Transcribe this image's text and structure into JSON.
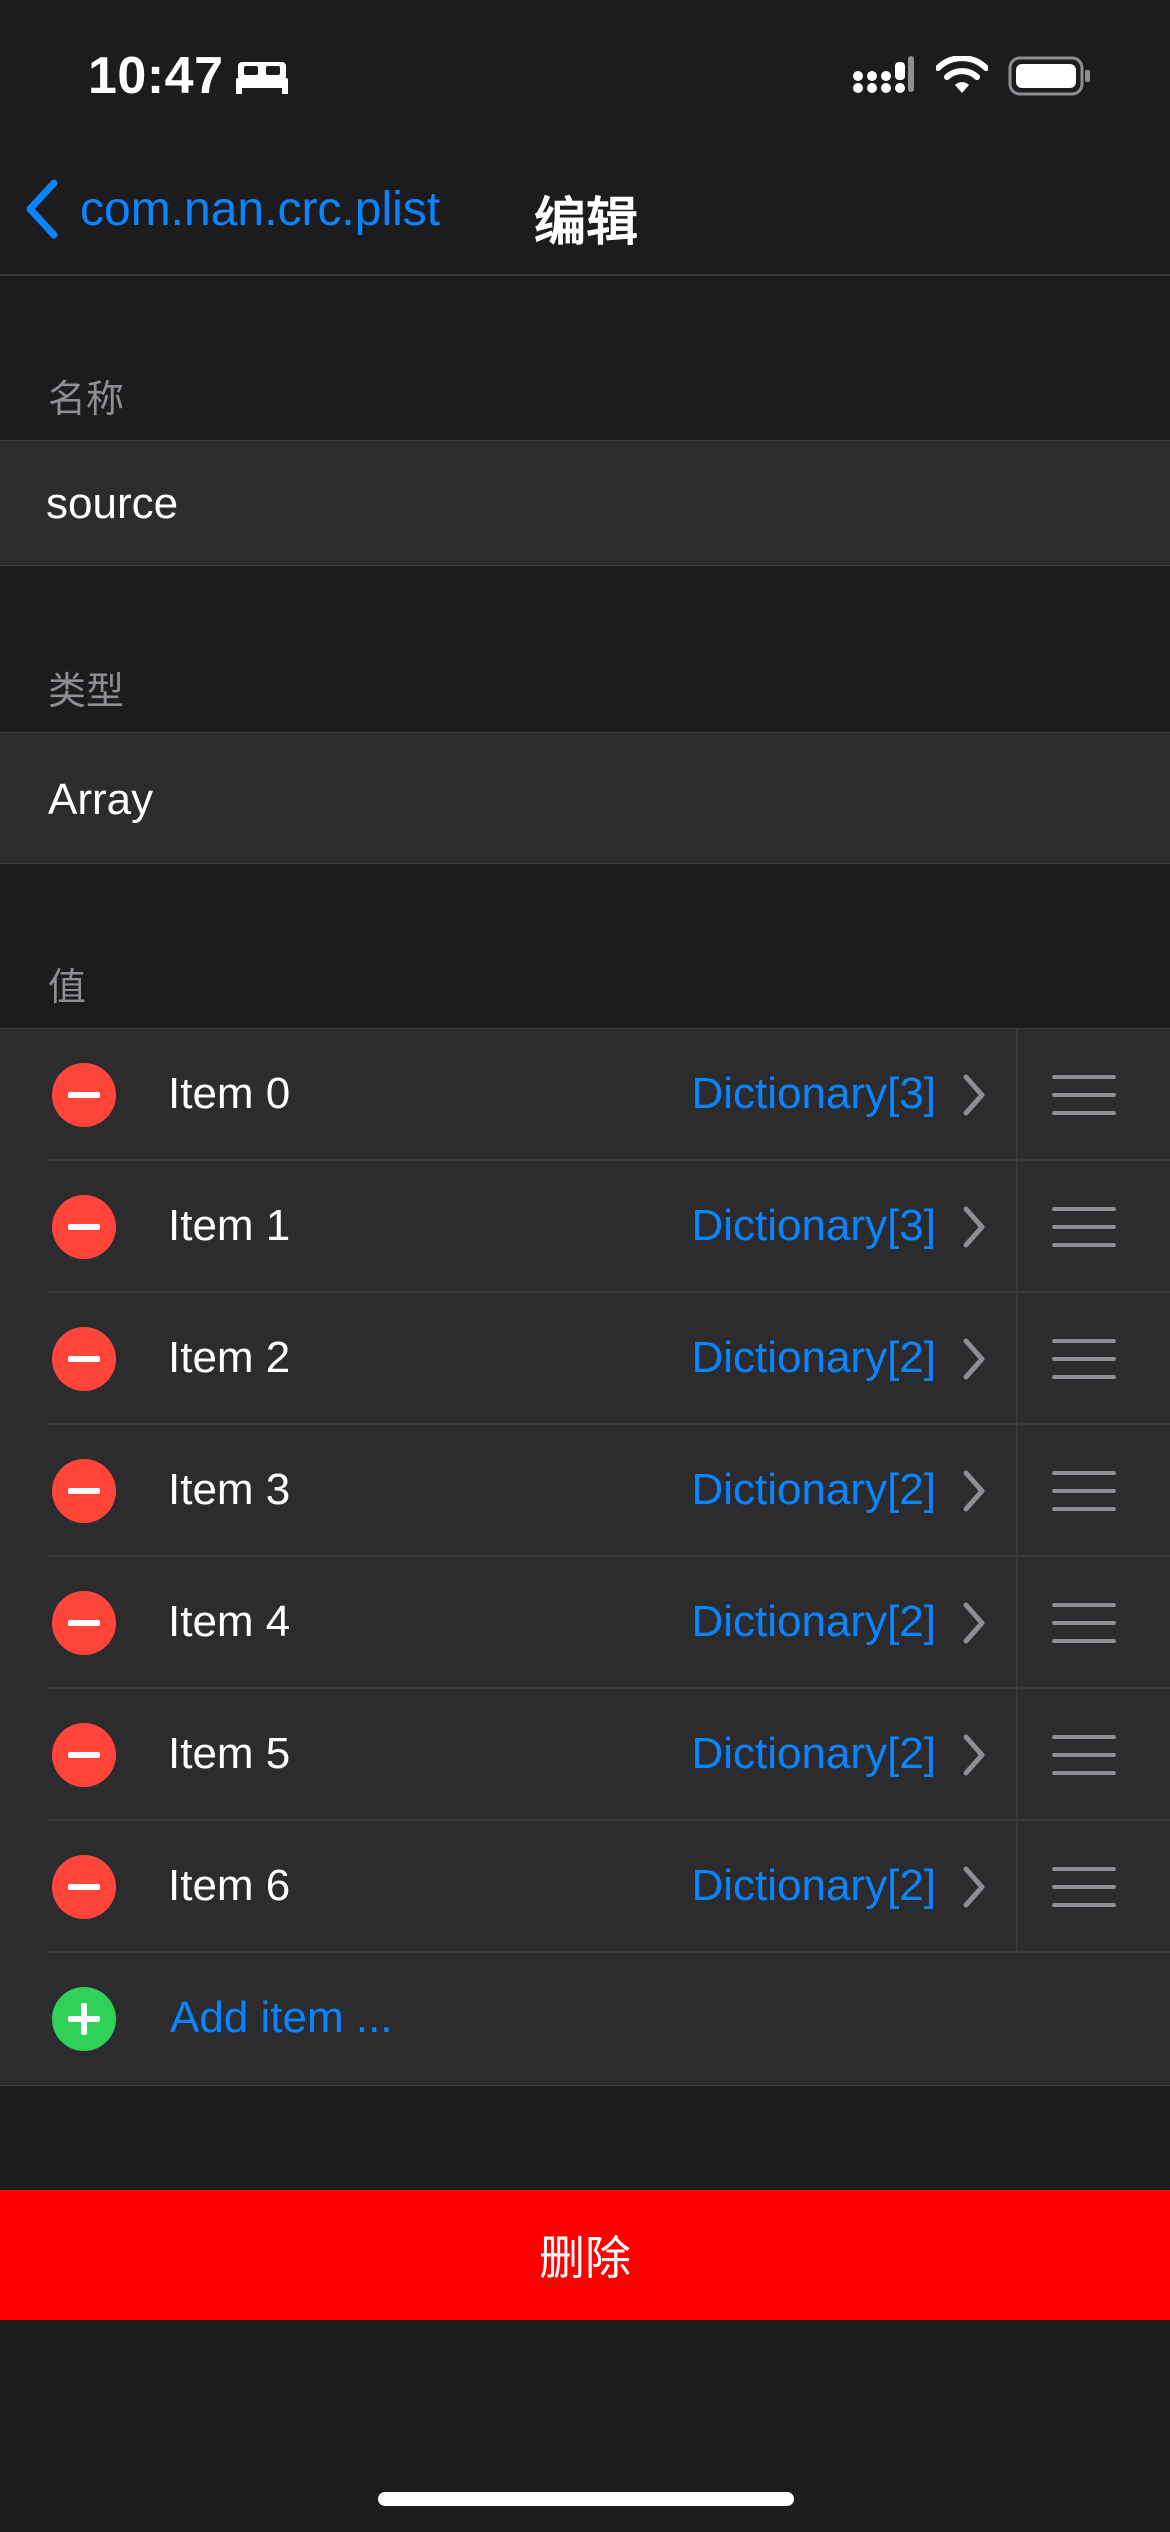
{
  "status_bar": {
    "time": "10:47"
  },
  "nav": {
    "back_label": "com.nan.crc.plist",
    "title": "编辑"
  },
  "name_section": {
    "header": "名称",
    "value": "source"
  },
  "type_section": {
    "header": "类型",
    "value": "Array"
  },
  "value_section": {
    "header": "值",
    "items": [
      {
        "label": "Item 0",
        "value": "Dictionary[3]"
      },
      {
        "label": "Item 1",
        "value": "Dictionary[3]"
      },
      {
        "label": "Item 2",
        "value": "Dictionary[2]"
      },
      {
        "label": "Item 3",
        "value": "Dictionary[2]"
      },
      {
        "label": "Item 4",
        "value": "Dictionary[2]"
      },
      {
        "label": "Item 5",
        "value": "Dictionary[2]"
      },
      {
        "label": "Item 6",
        "value": "Dictionary[2]"
      }
    ],
    "add_label": "Add item ..."
  },
  "delete_label": "删除",
  "colors": {
    "accent": "#0a84ff",
    "destructive": "#ff0000",
    "remove": "#ff453a",
    "add": "#30d158"
  }
}
